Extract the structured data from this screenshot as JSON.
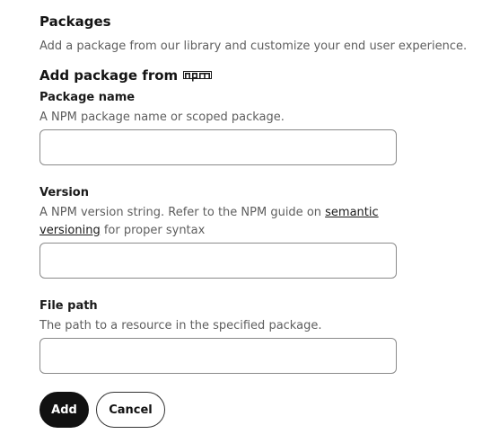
{
  "header": {
    "title": "Packages",
    "subtitle": "Add a package from our library and customize your end user experience."
  },
  "source": {
    "label": "Add package from",
    "logo_icon": "npm-logo"
  },
  "fields": {
    "package_name": {
      "label": "Package name",
      "help": "A NPM package name or scoped package.",
      "value": ""
    },
    "version": {
      "label": "Version",
      "help_before": "A NPM version string. Refer to the NPM guide on ",
      "help_link": "semantic versioning",
      "help_after": " for proper syntax",
      "value": ""
    },
    "file_path": {
      "label": "File path",
      "help": "The path to a resource in the specified package.",
      "value": ""
    }
  },
  "actions": {
    "add_label": "Add",
    "cancel_label": "Cancel"
  },
  "colors": {
    "primary_button": "#111111",
    "help_text": "#5e5e5e",
    "input_border": "#8a8a8a"
  }
}
